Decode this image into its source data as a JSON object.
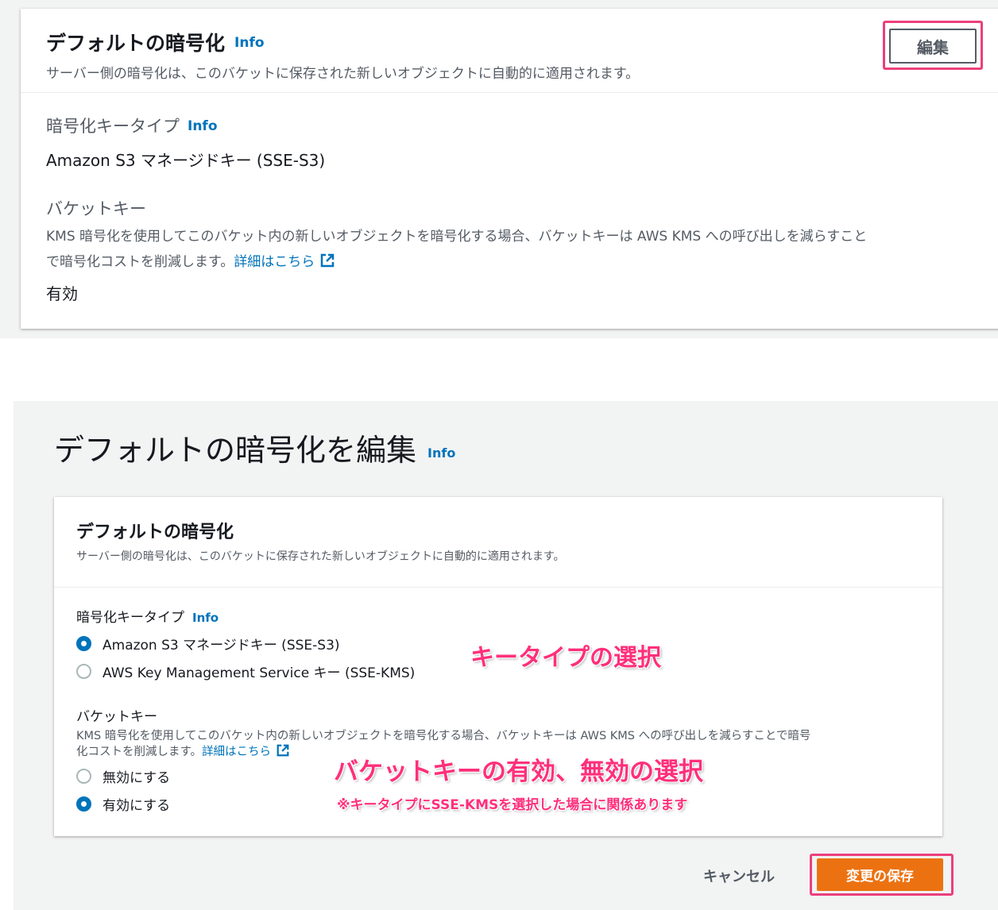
{
  "view_panel": {
    "title": "デフォルトの暗号化",
    "info": "Info",
    "description": "サーバー側の暗号化は、このバケットに保存された新しいオブジェクトに自動的に適用されます。",
    "edit_button": "編集",
    "encryption_type_label": "暗号化キータイプ",
    "encryption_type_info": "Info",
    "encryption_type_value": "Amazon S3 マネージドキー (SSE-S3)",
    "bucket_key_label": "バケットキー",
    "bucket_key_desc_line1": "KMS 暗号化を使用してこのバケット内の新しいオブジェクトを暗号化する場合、バケットキーは AWS KMS への呼び出しを減らすこと",
    "bucket_key_desc_line2": "で暗号化コストを削減します。",
    "learn_more": "詳細はこちら",
    "bucket_key_value": "有効"
  },
  "edit_page": {
    "title": "デフォルトの暗号化を編集",
    "info": "Info",
    "panel_title": "デフォルトの暗号化",
    "panel_description": "サーバー側の暗号化は、このバケットに保存された新しいオブジェクトに自動的に適用されます。",
    "encryption_type_label": "暗号化キータイプ",
    "encryption_type_info": "Info",
    "options": [
      {
        "label": "Amazon S3 マネージドキー (SSE-S3)",
        "selected": true
      },
      {
        "label": "AWS Key Management Service キー (SSE-KMS)",
        "selected": false
      }
    ],
    "bucket_key_label": "バケットキー",
    "bucket_key_desc_line1": "KMS 暗号化を使用してこのバケット内の新しいオブジェクトを暗号化する場合、バケットキーは AWS KMS への呼び出しを減らすことで暗号",
    "bucket_key_desc_line2": "化コストを削減します。",
    "learn_more": "詳細はこちら",
    "bucket_key_options": [
      {
        "label": "無効にする",
        "selected": false
      },
      {
        "label": "有効にする",
        "selected": true
      }
    ],
    "cancel_button": "キャンセル",
    "save_button": "変更の保存"
  },
  "annotations": {
    "key_type": "キータイプの選択",
    "bucket_key": "バケットキーの有効、無効の選択",
    "note": "※キータイプにSSE-KMSを選択した場合に関係あります"
  },
  "colors": {
    "link": "#0073bb",
    "primary_button": "#ec7211",
    "highlight": "#ec3f7c",
    "annotation": "#ff2f7a"
  }
}
